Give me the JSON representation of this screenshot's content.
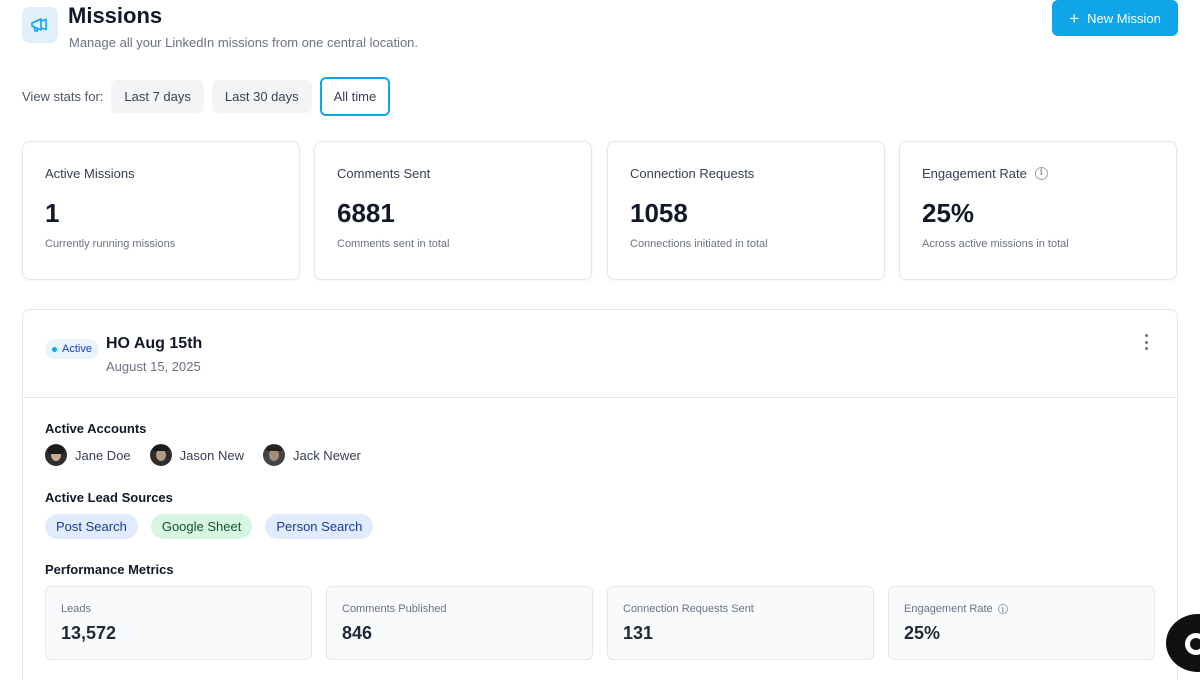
{
  "header": {
    "title": "Missions",
    "subtitle": "Manage all your LinkedIn missions from one central location.",
    "icon": "megaphone-icon",
    "new_mission_label": "New Mission"
  },
  "stats_filter": {
    "label": "View stats for:",
    "options": [
      "Last 7 days",
      "Last 30 days",
      "All time"
    ],
    "selected": "All time"
  },
  "stats": [
    {
      "label": "Active Missions",
      "value": "1",
      "sub": "Currently running missions"
    },
    {
      "label": "Comments Sent",
      "value": "6881",
      "sub": "Comments sent in total"
    },
    {
      "label": "Connection Requests",
      "value": "1058",
      "sub": "Connections initiated in total"
    },
    {
      "label": "Engagement Rate",
      "value": "25%",
      "sub": "Across active missions in total"
    }
  ],
  "mission": {
    "status": "Active",
    "title": "HO Aug 15th",
    "date": "August 15, 2025",
    "accounts_title": "Active Accounts",
    "accounts": [
      "Jane Doe",
      "Jason New",
      "Jack Newer"
    ],
    "lead_sources_title": "Active Lead Sources",
    "lead_sources": [
      "Post Search",
      "Google Sheet",
      "Person Search"
    ],
    "metrics_title": "Performance Metrics",
    "metrics": [
      {
        "label": "Leads",
        "value": "13,572"
      },
      {
        "label": "Comments Published",
        "value": "846"
      },
      {
        "label": "Connection Requests Sent",
        "value": "131"
      },
      {
        "label": "Engagement Rate",
        "value": "25%"
      }
    ]
  },
  "colors": {
    "accent": "#0ea5e9",
    "badge_bg": "#eaf4fd",
    "pill_blue": "#e0ebfd",
    "pill_green": "#d7f5e3"
  }
}
